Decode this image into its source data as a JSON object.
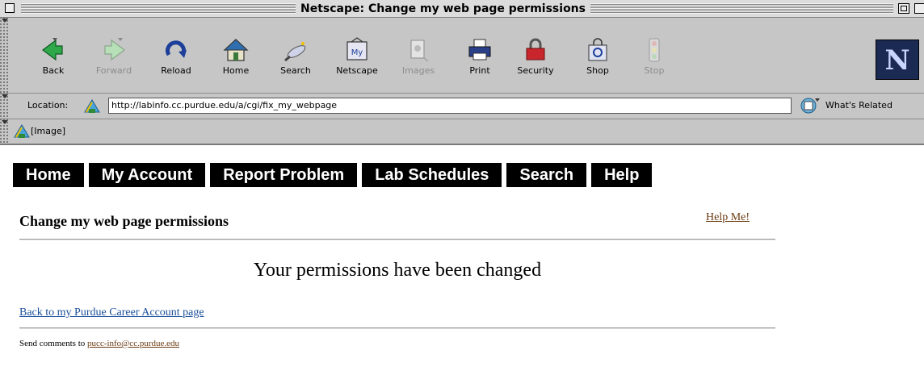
{
  "window": {
    "title": "Netscape: Change my web page permissions"
  },
  "toolbar": {
    "buttons": [
      {
        "label": "Back",
        "icon": "back-arrow-icon",
        "enabled": true
      },
      {
        "label": "Forward",
        "icon": "forward-arrow-icon",
        "enabled": false
      },
      {
        "label": "Reload",
        "icon": "reload-icon",
        "enabled": true
      },
      {
        "label": "Home",
        "icon": "home-icon",
        "enabled": true
      },
      {
        "label": "Search",
        "icon": "search-icon",
        "enabled": true
      },
      {
        "label": "Netscape",
        "icon": "netscape-my-icon",
        "enabled": true
      },
      {
        "label": "Images",
        "icon": "images-icon",
        "enabled": false
      },
      {
        "label": "Print",
        "icon": "printer-icon",
        "enabled": true
      },
      {
        "label": "Security",
        "icon": "lock-icon",
        "enabled": true
      },
      {
        "label": "Shop",
        "icon": "shopping-bag-icon",
        "enabled": true
      },
      {
        "label": "Stop",
        "icon": "stop-light-icon",
        "enabled": false
      }
    ],
    "logo": "N"
  },
  "location": {
    "label": "Location:",
    "url": "http://labinfo.cc.purdue.edu/a/cgi/fix_my_webpage",
    "related_label": "What's Related"
  },
  "personal_toolbar": {
    "item_label": "[Image]"
  },
  "page": {
    "nav_tabs": [
      "Home",
      "My Account",
      "Report Problem",
      "Lab Schedules",
      "Search",
      "Help"
    ],
    "title": "Change my web page permissions",
    "help_link": "Help Me!",
    "message": "Your permissions have been changed",
    "back_link": "Back to my Purdue Career Account page",
    "footer_prefix": "Send comments to ",
    "footer_email": "pucc-info@cc.purdue.edu"
  },
  "colors": {
    "chrome": "#c6c6c6",
    "nav_tab_bg": "#000000",
    "link_blue": "#1b4f99",
    "link_brown": "#6b3b12"
  }
}
